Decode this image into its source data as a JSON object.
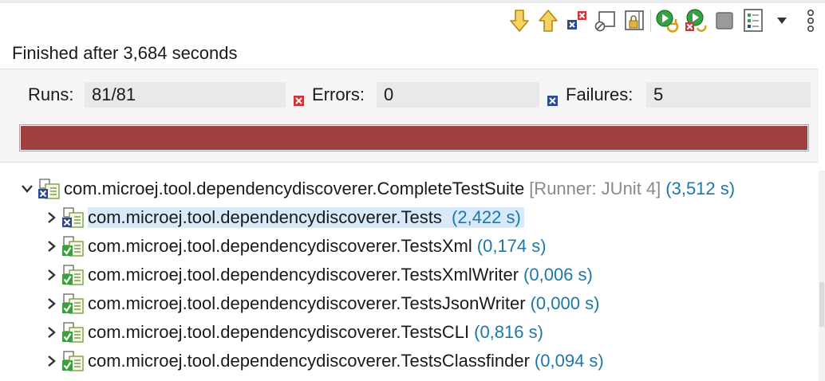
{
  "status": {
    "text": "Finished after 3,684 seconds"
  },
  "toolbar": {
    "buttons": [
      {
        "name": "next-failure-icon"
      },
      {
        "name": "previous-failure-icon"
      },
      {
        "name": "show-failures-only-icon"
      },
      {
        "name": "show-skipped-only-icon"
      },
      {
        "name": "scroll-lock-icon"
      },
      {
        "name": "rerun-test-icon"
      },
      {
        "name": "rerun-failures-first-icon"
      },
      {
        "name": "stop-icon"
      },
      {
        "name": "test-run-history-icon"
      },
      {
        "name": "view-menu-icon"
      },
      {
        "name": "more-icon"
      }
    ]
  },
  "counters": {
    "runs_label": "Runs:",
    "runs_value": "81/81",
    "errors_label": "Errors:",
    "errors_value": "0",
    "failures_label": "Failures:",
    "failures_value": "5"
  },
  "progress": {
    "fraction": 1.0,
    "color": "#a04040"
  },
  "colors": {
    "time": "#1c78a8",
    "runner": "#8a8a8a",
    "selection": "#d8e9fa",
    "failure": "#a04040",
    "pass": "#3f9e3f"
  },
  "tree": {
    "root": {
      "name": "com.microej.tool.dependencydiscoverer.CompleteTestSuite",
      "runner": "[Runner: JUnit 4]",
      "time": "(3,512 s)",
      "status": "failed"
    },
    "children": [
      {
        "name": "com.microej.tool.dependencydiscoverer.Tests",
        "time": "(2,422 s)",
        "status": "failed"
      },
      {
        "name": "com.microej.tool.dependencydiscoverer.TestsXml",
        "time": "(0,174 s)",
        "status": "passed"
      },
      {
        "name": "com.microej.tool.dependencydiscoverer.TestsXmlWriter",
        "time": "(0,006 s)",
        "status": "passed"
      },
      {
        "name": "com.microej.tool.dependencydiscoverer.TestsJsonWriter",
        "time": "(0,000 s)",
        "status": "passed"
      },
      {
        "name": "com.microej.tool.dependencydiscoverer.TestsCLI",
        "time": "(0,816 s)",
        "status": "passed"
      },
      {
        "name": "com.microej.tool.dependencydiscoverer.TestsClassfinder",
        "time": "(0,094 s)",
        "status": "passed"
      }
    ]
  }
}
